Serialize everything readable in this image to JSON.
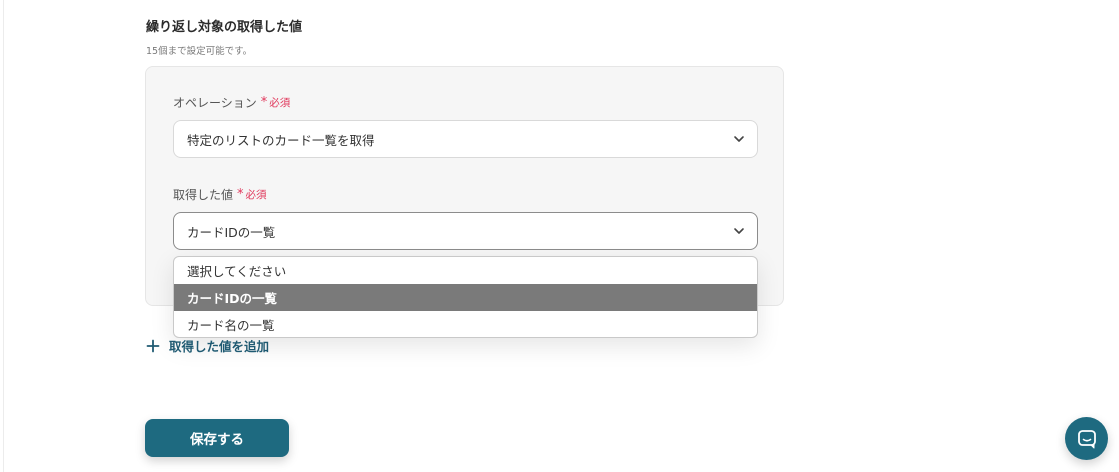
{
  "section": {
    "title": "繰り返し対象の取得した値",
    "note": "15個まで設定可能です。"
  },
  "operation": {
    "label": "オペレーション",
    "required_mark": "*",
    "required_text": "必須",
    "value": "特定のリストのカード一覧を取得"
  },
  "retrieved_value": {
    "label": "取得した値",
    "required_mark": "*",
    "required_text": "必須",
    "value": "カードIDの一覧",
    "options": [
      "選択してください",
      "カードIDの一覧",
      "カード名の一覧"
    ],
    "selected_index": 1
  },
  "add_link": {
    "label": "取得した値を追加"
  },
  "save_button": {
    "label": "保存する"
  },
  "colors": {
    "accent": "#1e6a80",
    "required": "#e0365a",
    "selected_option_bg": "#7a7a7a"
  },
  "icons": {
    "chevron": "chevron-down-icon",
    "plus": "plus-icon",
    "chat": "chat-bubble-icon"
  }
}
